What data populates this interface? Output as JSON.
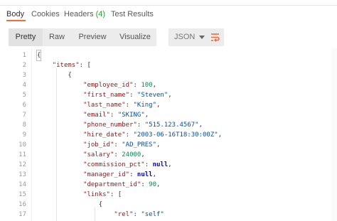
{
  "tabs": [
    {
      "label": "Body",
      "count": ""
    },
    {
      "label": "Cookies",
      "count": ""
    },
    {
      "label": "Headers",
      "count": "(4)"
    },
    {
      "label": "Test Results",
      "count": ""
    }
  ],
  "active_tab": "Body",
  "view_modes": [
    "Pretty",
    "Raw",
    "Preview",
    "Visualize"
  ],
  "active_view_mode": "Pretty",
  "format_select": {
    "value": "JSON",
    "icon": "chevron-down-icon"
  },
  "wrap_button": {
    "icon": "wrap-lines-icon",
    "color": "#f26b3a"
  },
  "colors": {
    "accent": "#f26b3a",
    "key": "#a31515",
    "string": "#0451a5",
    "number": "#098658",
    "literal": "#0000ff"
  },
  "editor": {
    "lines": [
      {
        "num": "1",
        "indent": "",
        "tokens": [
          {
            "t": "p",
            "v": "{"
          }
        ]
      },
      {
        "num": "2",
        "indent": "    ",
        "tokens": [
          {
            "t": "k",
            "v": "\"items\""
          },
          {
            "t": "p",
            "v": ": ["
          }
        ]
      },
      {
        "num": "3",
        "indent": "        ",
        "tokens": [
          {
            "t": "p",
            "v": "{"
          }
        ]
      },
      {
        "num": "4",
        "indent": "            ",
        "tokens": [
          {
            "t": "k",
            "v": "\"employee_id\""
          },
          {
            "t": "p",
            "v": ": "
          },
          {
            "t": "n",
            "v": "100"
          },
          {
            "t": "p",
            "v": ","
          }
        ]
      },
      {
        "num": "5",
        "indent": "            ",
        "tokens": [
          {
            "t": "k",
            "v": "\"first_name\""
          },
          {
            "t": "p",
            "v": ": "
          },
          {
            "t": "s",
            "v": "\"Steven\""
          },
          {
            "t": "p",
            "v": ","
          }
        ]
      },
      {
        "num": "6",
        "indent": "            ",
        "tokens": [
          {
            "t": "k",
            "v": "\"last_name\""
          },
          {
            "t": "p",
            "v": ": "
          },
          {
            "t": "s",
            "v": "\"King\""
          },
          {
            "t": "p",
            "v": ","
          }
        ]
      },
      {
        "num": "7",
        "indent": "            ",
        "tokens": [
          {
            "t": "k",
            "v": "\"email\""
          },
          {
            "t": "p",
            "v": ": "
          },
          {
            "t": "s",
            "v": "\"SKING\""
          },
          {
            "t": "p",
            "v": ","
          }
        ]
      },
      {
        "num": "8",
        "indent": "            ",
        "tokens": [
          {
            "t": "k",
            "v": "\"phone_number\""
          },
          {
            "t": "p",
            "v": ": "
          },
          {
            "t": "s",
            "v": "\"515.123.4567\""
          },
          {
            "t": "p",
            "v": ","
          }
        ]
      },
      {
        "num": "9",
        "indent": "            ",
        "tokens": [
          {
            "t": "k",
            "v": "\"hire_date\""
          },
          {
            "t": "p",
            "v": ": "
          },
          {
            "t": "s",
            "v": "\"2003-06-16T18:30:00Z\""
          },
          {
            "t": "p",
            "v": ","
          }
        ]
      },
      {
        "num": "10",
        "indent": "            ",
        "tokens": [
          {
            "t": "k",
            "v": "\"job_id\""
          },
          {
            "t": "p",
            "v": ": "
          },
          {
            "t": "s",
            "v": "\"AD_PRES\""
          },
          {
            "t": "p",
            "v": ","
          }
        ]
      },
      {
        "num": "11",
        "indent": "            ",
        "tokens": [
          {
            "t": "k",
            "v": "\"salary\""
          },
          {
            "t": "p",
            "v": ": "
          },
          {
            "t": "n",
            "v": "24000"
          },
          {
            "t": "p",
            "v": ","
          }
        ]
      },
      {
        "num": "12",
        "indent": "            ",
        "tokens": [
          {
            "t": "k",
            "v": "\"commission_pct\""
          },
          {
            "t": "p",
            "v": ": "
          },
          {
            "t": "lit",
            "v": "null"
          },
          {
            "t": "p",
            "v": ","
          }
        ]
      },
      {
        "num": "13",
        "indent": "            ",
        "tokens": [
          {
            "t": "k",
            "v": "\"manager_id\""
          },
          {
            "t": "p",
            "v": ": "
          },
          {
            "t": "lit",
            "v": "null"
          },
          {
            "t": "p",
            "v": ","
          }
        ]
      },
      {
        "num": "14",
        "indent": "            ",
        "tokens": [
          {
            "t": "k",
            "v": "\"department_id\""
          },
          {
            "t": "p",
            "v": ": "
          },
          {
            "t": "n",
            "v": "90"
          },
          {
            "t": "p",
            "v": ","
          }
        ]
      },
      {
        "num": "15",
        "indent": "            ",
        "tokens": [
          {
            "t": "k",
            "v": "\"links\""
          },
          {
            "t": "p",
            "v": ": ["
          }
        ]
      },
      {
        "num": "16",
        "indent": "                ",
        "tokens": [
          {
            "t": "p",
            "v": "{"
          }
        ]
      },
      {
        "num": "17",
        "indent": "                    ",
        "tokens": [
          {
            "t": "k",
            "v": "\"rel\""
          },
          {
            "t": "p",
            "v": ": "
          },
          {
            "t": "s",
            "v": "\"self\""
          }
        ]
      }
    ]
  }
}
